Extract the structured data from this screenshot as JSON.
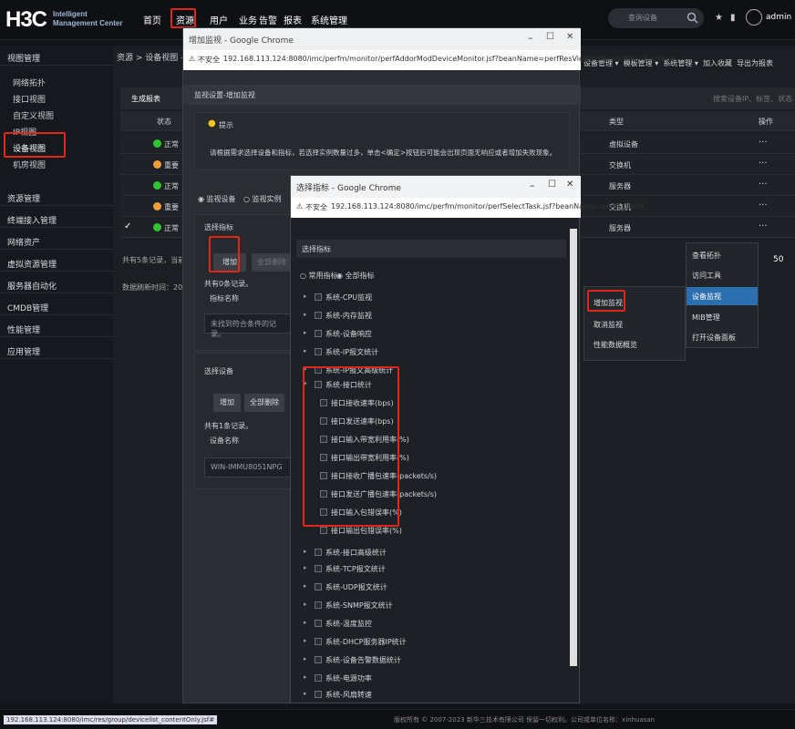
{
  "top_nav": {
    "logo_text": "H3C",
    "logo_line1": "Intelligent",
    "logo_line2": "Management Center",
    "items": [
      "首页",
      "资源",
      "用户",
      "业务",
      "告警",
      "报表",
      "系统管理"
    ],
    "search_placeholder": "查询设备",
    "user": "admin"
  },
  "sidebar": {
    "sections": [
      {
        "title": "视图管理",
        "items": [
          "网络拓扑",
          "接口视图",
          "自定义视图",
          "IP视图",
          "设备视图",
          "机房视图"
        ]
      },
      {
        "title": "资源管理"
      },
      {
        "title": "终端接入管理"
      },
      {
        "title": "网络资产"
      },
      {
        "title": "虚拟资源管理"
      },
      {
        "title": "服务器自动化"
      },
      {
        "title": "CMDB管理"
      },
      {
        "title": "性能管理"
      },
      {
        "title": "应用管理"
      }
    ]
  },
  "main": {
    "breadcrumb": "资源 > 设备视图 - 全部 - 所有设备",
    "toolbar": {
      "generate_label": "生成报表",
      "delete_label": "删除"
    },
    "columns": {
      "status": "状态",
      "type": "类型",
      "action": "操作"
    },
    "rows": [
      {
        "status": "正常",
        "status_color": "#2fc52f",
        "type": "虚拟设备",
        "action": "···"
      },
      {
        "status": "重要",
        "status_color": "#f39c3a",
        "type": "交换机",
        "action": "···"
      },
      {
        "status": "正常",
        "status_color": "#2fc52f",
        "type": "服务器",
        "action": "···"
      },
      {
        "status": "重要",
        "status_color": "#f39c3a",
        "type": "交换机",
        "action": "···"
      },
      {
        "status": "正常",
        "status_color": "#2fc52f",
        "type": "服务器",
        "action": "···"
      }
    ],
    "total_text": "共有5条记录，当前第1 - 5",
    "refresh_text": "数据刷新时间：2023-11-07",
    "page_size": "50",
    "search_hint": "搜索设备IP、标签、状态",
    "top_actions": [
      "设备管理",
      "模板管理",
      "系统管理",
      "加入收藏",
      "导出为报表",
      "帮助"
    ]
  },
  "win1": {
    "title": "增加监视 - Google Chrome",
    "insecure": "不安全",
    "url": "192.168.113.124:8080/imc/perfm/monitor/perfAddorModDeviceMonitor.jsf?beanName=perfResViewExtensionBean&extend...",
    "header": "监视设置-增加监视",
    "tip_title": "提示",
    "tip_text": "请根据需求选择设备和指标，若选择实例数量过多，单击<确定>按钮后可能会出现页面无响应或者增加失败现象。",
    "radio_device": "监视设备",
    "radio_instance": "监视实例",
    "select_metric_title": "选择指标",
    "add_label": "增加",
    "remove_all_label": "全部删除",
    "metric_count": "共有0条记录。",
    "metric_col": "指标名称",
    "metric_empty": "未找到符合条件的记录。",
    "select_device_title": "选择设备",
    "device_count": "共有1条记录。",
    "device_col": "设备名称",
    "device_value": "WIN-IMMU8051NPG"
  },
  "win2": {
    "title": "选择指标 - Google Chrome",
    "insecure": "不安全",
    "url": "192.168.113.124:8080/imc/perfm/monitor/perfSelectTask.jsf?beanName=perfAddorM...",
    "header": "选择指标",
    "radio_common": "常用指标",
    "radio_all": "全部指标",
    "tree": [
      "系统-CPU监视",
      "系统-内存监视",
      "系统-设备响应",
      "系统-IP报文统计",
      "系统-IP报文高级统计",
      "系统-接口统计"
    ],
    "interface_children": [
      "接口接收速率(bps)",
      "接口发送速率(bps)",
      "接口输入带宽利用率(%)",
      "接口输出带宽利用率(%)",
      "接口接收广播包速率(packets/s)",
      "接口发送广播包速率(packets/s)",
      "接口输入包错误率(%)",
      "接口输出包错误率(%)"
    ],
    "tree_after": [
      "系统-接口高级统计",
      "系统-TCP报文统计",
      "系统-UDP报文统计",
      "系统-SNMP报文统计",
      "系统-温度监控",
      "系统-DHCP服务器IP统计",
      "系统-设备告警数据统计",
      "系统-电源功率",
      "系统-风扇转速"
    ]
  },
  "ctx_menu": {
    "main": [
      "查看拓扑",
      "访问工具",
      "设备监视",
      "MIB管理",
      "打开设备面板"
    ],
    "sub": [
      "增加监视",
      "取消监视",
      "性能数据概览"
    ]
  },
  "footer": {
    "status_url": "192.168.113.124:8080/imc/res/group/devicelist_contentOnly.jsf#",
    "copyright": "版权所有 © 2007-2023 新华三技术有限公司  保留一切权利。公司或单位名称：xinhuasan"
  }
}
